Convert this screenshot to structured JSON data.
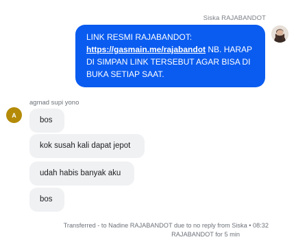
{
  "outgoing": {
    "sender_name": "Siska RAJABANDOT",
    "text_line1": "LINK RESMI RAJABANDOT:",
    "link_text": "https://gasmain.me/rajabandot",
    "text_rest": " NB. HARAP DI SIMPAN LINK TERSEBUT AGAR BISA DI BUKA SETIAP SAAT.",
    "bubble_color": "#0a5cf0"
  },
  "incoming": {
    "sender_name": "agmad supi yono",
    "avatar_initial": "A",
    "avatar_color": "#b48a07",
    "messages": [
      {
        "text": "bos"
      },
      {
        "text": "kok susah kali dapat jepot"
      },
      {
        "text": "udah habis banyak aku"
      },
      {
        "text": "bos"
      }
    ]
  },
  "system": {
    "line1": "Transferred - to Nadine RAJABANDOT due to no reply from Siska • 08:32",
    "line2": "RAJABANDOT for 5 min"
  }
}
